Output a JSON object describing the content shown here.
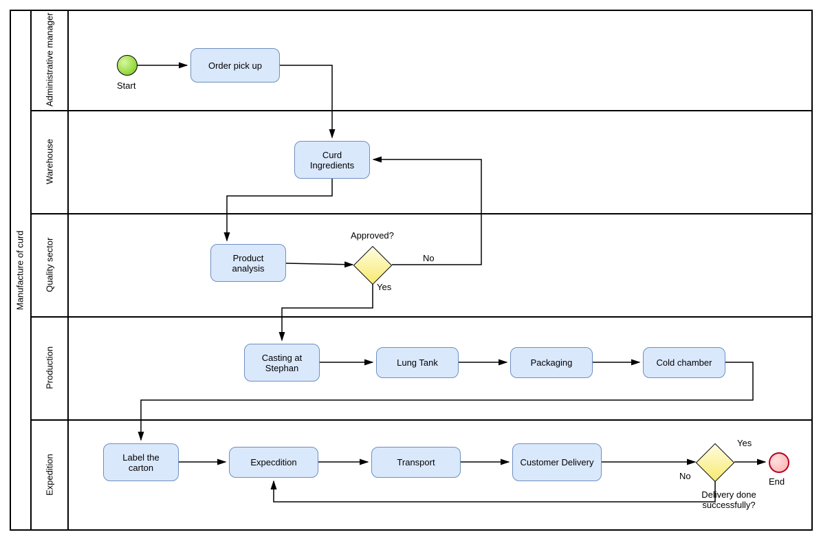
{
  "pool": {
    "title": "Manufacture of curd"
  },
  "lanes": {
    "admin": "Administrative manager",
    "warehouse": "Warehouse",
    "quality": "Quality sector",
    "production": "Production",
    "expedition": "Expedition"
  },
  "tasks": {
    "order_pickup": "Order pick up",
    "curd_ingredients": "Curd Ingredients",
    "product_analysis": "Product analysis",
    "casting": "Casting at Stephan",
    "lung_tank": "Lung Tank",
    "packaging": "Packaging",
    "cold_chamber": "Cold chamber",
    "label_carton": "Label the carton",
    "expedition": "Expecdition",
    "transport": "Transport",
    "customer_delivery": "Customer Delivery"
  },
  "events": {
    "start_label": "Start",
    "end_label": "End"
  },
  "gateways": {
    "approved_label": "Approved?",
    "approved_yes": "Yes",
    "approved_no": "No",
    "delivery_label": "Delivery done successfully?",
    "delivery_yes": "Yes",
    "delivery_no": "No"
  }
}
